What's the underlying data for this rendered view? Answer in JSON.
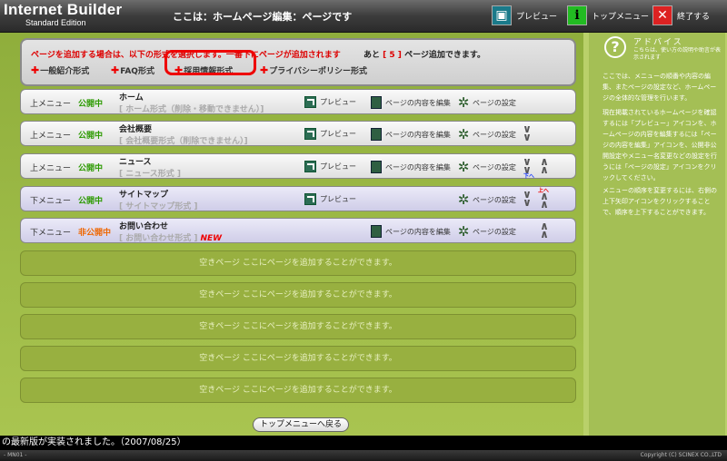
{
  "header": {
    "logo_main": "Internet Builder",
    "logo_sub": "Standard Edition",
    "title": "ここは：ホームページ編集：ページです",
    "preview_label": "プレビュー",
    "top_label": "トップメニュー",
    "end_label": "終了する"
  },
  "addbox": {
    "message": "ページを追加する場合は、以下の形式を選択します。一番下にページが追加されます",
    "remain_prefix": "あと",
    "remain_count": "[ 5 ]",
    "remain_suffix": "ページ追加できます。",
    "links": [
      "一般紹介形式",
      "FAQ形式",
      "採用情報形式",
      "プライバシーポリシー形式"
    ]
  },
  "actions": {
    "preview": "プレビュー",
    "edit": "ページの内容を編集",
    "settings": "ページの設定"
  },
  "rows": [
    {
      "menu": "上メニュー",
      "status": "公開中",
      "name": "ホーム",
      "form": "[ ホーム形式（削除・移動できません）]"
    },
    {
      "menu": "上メニュー",
      "status": "公開中",
      "name": "会社概要",
      "form": "[ 会社概要形式（削除できません）]"
    },
    {
      "menu": "上メニュー",
      "status": "公開中",
      "name": "ニュース",
      "form": "[ ニュース形式 ]"
    },
    {
      "menu": "下メニュー",
      "status": "公開中",
      "name": "サイトマップ",
      "form": "[ サイトマップ形式 ]"
    },
    {
      "menu": "下メニュー",
      "status": "非公開中",
      "name": "お問い合わせ",
      "form": "[ お問い合わせ形式 ]",
      "badge": "NEW"
    }
  ],
  "move_labels": {
    "down": "下へ",
    "up": "上へ"
  },
  "empty_row": "空きページ ここにページを追加することができます。",
  "back_button": "トップメニューへ戻る",
  "advice": {
    "title": "アドバイス",
    "subtitle": "こちらは、使い方の説明や助言が表示されます",
    "p1": "ここでは、メニューの順番や内容の編集、またページの設定など、ホームページの全体的な管理を行います。",
    "p2": "現在掲載されているホームページを確認するには「プレビュー」アイコンを、ホームページの内容を編集するには「ページの内容を編集」アイコンを、公開非公開設定やメニュー名変更などの設定を行うには「ページの設定」アイコンをクリックしてください。",
    "p3": "メニューの順序を変更するには、右側の上下矢印アイコンをクリックすることで、順序を上下することができます。"
  },
  "ticker": "の最新版が実装されました。（2007/08/25）",
  "status_left": "- MN01 -",
  "status_right": "Copyright (C) SCINEX CO.,LTD",
  "colors": {
    "accent_green": "#9fbc48",
    "public": "#2c9a00",
    "private": "#ee6600",
    "highlight": "#e00000"
  }
}
